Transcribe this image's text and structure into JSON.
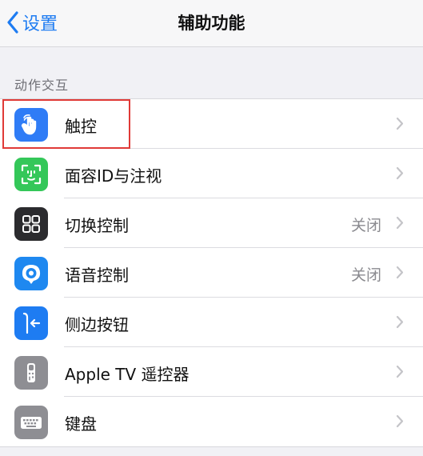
{
  "nav": {
    "back_label": "设置",
    "title": "辅助功能"
  },
  "section": {
    "title": "动作交互"
  },
  "items": [
    {
      "label": "触控",
      "value": "",
      "icon": "hand-pointer-icon",
      "color": "#2f7cf6"
    },
    {
      "label": "面容ID与注视",
      "value": "",
      "icon": "face-id-icon",
      "color": "#34c759"
    },
    {
      "label": "切换控制",
      "value": "关闭",
      "icon": "switch-control-icon",
      "color": "#2b2b2e"
    },
    {
      "label": "语音控制",
      "value": "关闭",
      "icon": "voice-control-icon",
      "color": "#1e88f0"
    },
    {
      "label": "侧边按钮",
      "value": "",
      "icon": "side-button-icon",
      "color": "#1e7cf2"
    },
    {
      "label": "Apple TV 遥控器",
      "value": "",
      "icon": "tv-remote-icon",
      "color": "#8e8e93"
    },
    {
      "label": "键盘",
      "value": "",
      "icon": "keyboard-icon",
      "color": "#8e8e93"
    }
  ],
  "colors": {
    "accent": "#1e7cf2",
    "highlight_border": "#e03a37"
  }
}
